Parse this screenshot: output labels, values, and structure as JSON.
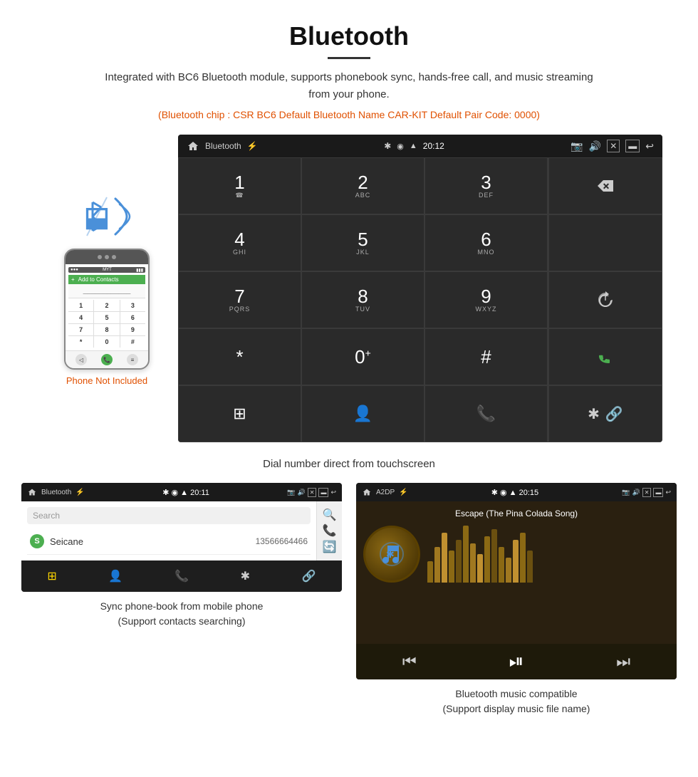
{
  "header": {
    "title": "Bluetooth",
    "description": "Integrated with BC6 Bluetooth module, supports phonebook sync, hands-free call, and music streaming from your phone.",
    "specs": "(Bluetooth chip : CSR BC6    Default Bluetooth Name CAR-KIT    Default Pair Code: 0000)"
  },
  "phone_note": "Phone Not Included",
  "car_screen": {
    "status_bar": {
      "app_name": "Bluetooth",
      "time": "20:12"
    },
    "dialpad": {
      "keys": [
        {
          "main": "1",
          "sub": ""
        },
        {
          "main": "2",
          "sub": "ABC"
        },
        {
          "main": "3",
          "sub": "DEF"
        },
        {
          "main": "4",
          "sub": "GHI"
        },
        {
          "main": "5",
          "sub": "JKL"
        },
        {
          "main": "6",
          "sub": "MNO"
        },
        {
          "main": "7",
          "sub": "PQRS"
        },
        {
          "main": "8",
          "sub": "TUV"
        },
        {
          "main": "9",
          "sub": "WXYZ"
        },
        {
          "main": "*",
          "sub": ""
        },
        {
          "main": "0",
          "sub": "+"
        },
        {
          "main": "#",
          "sub": ""
        }
      ]
    }
  },
  "dial_caption": "Dial number direct from touchscreen",
  "contacts_screen": {
    "status_bar": {
      "app_name": "Bluetooth",
      "time": "20:11"
    },
    "search_placeholder": "Search",
    "contacts": [
      {
        "letter": "S",
        "name": "Seicane",
        "number": "13566664466"
      }
    ]
  },
  "contacts_caption_line1": "Sync phone-book from mobile phone",
  "contacts_caption_line2": "(Support contacts searching)",
  "music_screen": {
    "status_bar": {
      "app_name": "A2DP",
      "time": "20:15"
    },
    "song_title": "Escape (The Pina Colada Song)",
    "viz_bars": [
      30,
      50,
      70,
      45,
      60,
      80,
      55,
      40,
      65,
      75,
      50,
      35,
      60,
      70,
      45
    ]
  },
  "music_caption_line1": "Bluetooth music compatible",
  "music_caption_line2": "(Support display music file name)"
}
